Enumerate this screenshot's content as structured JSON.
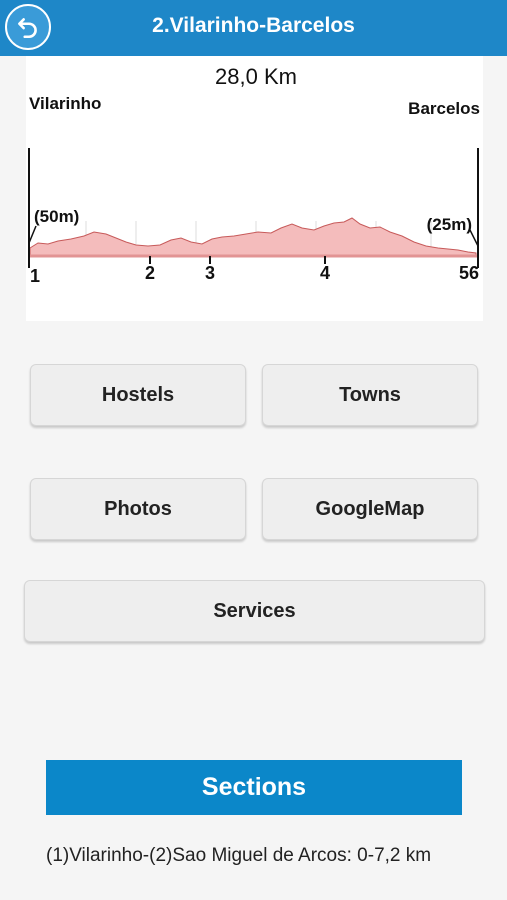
{
  "header": {
    "title": "2.Vilarinho-Barcelos",
    "back_icon": "back-arrow-icon"
  },
  "profile": {
    "distance": "28,0 Km",
    "start_town": "Vilarinho",
    "end_town": "Barcelos",
    "start_elevation": "(50m)",
    "end_elevation": "(25m)",
    "markers": [
      "1",
      "2",
      "3",
      "4",
      "56"
    ],
    "fill_color": "#f4bcbc",
    "line_color": "#c75a5a"
  },
  "buttons": {
    "hostels": "Hostels",
    "towns": "Towns",
    "photos": "Photos",
    "googlemap": "GoogleMap",
    "services": "Services"
  },
  "sections": {
    "title": "Sections",
    "items": [
      "(1)Vilarinho-(2)Sao Miguel de Arcos: 0-7,2 km"
    ]
  },
  "colors": {
    "header": "#1e87c8",
    "sections_bar": "#0b87c9"
  }
}
